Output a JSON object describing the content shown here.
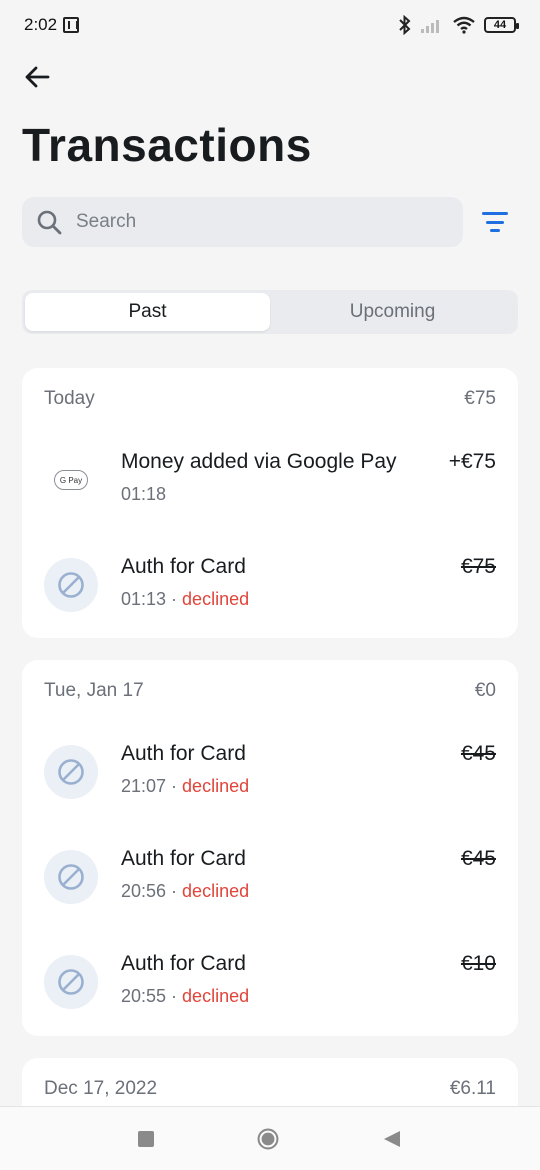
{
  "status_bar": {
    "time": "2:02",
    "battery": "44",
    "icons": [
      "nfc-icon",
      "bluetooth-icon",
      "signal-icon",
      "wifi-icon",
      "battery-icon"
    ]
  },
  "header": {
    "back_icon": "arrow-left-icon",
    "title": "Transactions"
  },
  "search": {
    "placeholder": "Search",
    "icon": "search-icon",
    "filter_icon": "filter-icon"
  },
  "tabs": [
    {
      "label": "Past",
      "active": true
    },
    {
      "label": "Upcoming",
      "active": false
    }
  ],
  "groups": [
    {
      "date": "Today",
      "total": "€75",
      "items": [
        {
          "icon": "google-pay-icon",
          "badge": "G Pay",
          "title": "Money added via Google Pay",
          "time": "01:18",
          "status": "",
          "amount": "+€75",
          "struck": false
        },
        {
          "icon": "declined-icon",
          "title": "Auth for Card",
          "time": "01:13",
          "separator": " · ",
          "status": "declined",
          "amount": "€75",
          "struck": true
        }
      ]
    },
    {
      "date": "Tue, Jan 17",
      "total": "€0",
      "items": [
        {
          "icon": "declined-icon",
          "title": "Auth for Card",
          "time": "21:07",
          "separator": " · ",
          "status": "declined",
          "amount": "€45",
          "struck": true
        },
        {
          "icon": "declined-icon",
          "title": "Auth for Card",
          "time": "20:56",
          "separator": " · ",
          "status": "declined",
          "amount": "€45",
          "struck": true
        },
        {
          "icon": "declined-icon",
          "title": "Auth for Card",
          "time": "20:55",
          "separator": " · ",
          "status": "declined",
          "amount": "€10",
          "struck": true
        }
      ]
    },
    {
      "date": "Dec 17, 2022",
      "total": "€6.11",
      "items": []
    }
  ],
  "colors": {
    "accent": "#1f6fe0",
    "declined": "#e0453a",
    "background": "#f5f5f6"
  },
  "nav": {
    "icons": [
      "recents-icon",
      "home-icon",
      "back-icon"
    ]
  }
}
